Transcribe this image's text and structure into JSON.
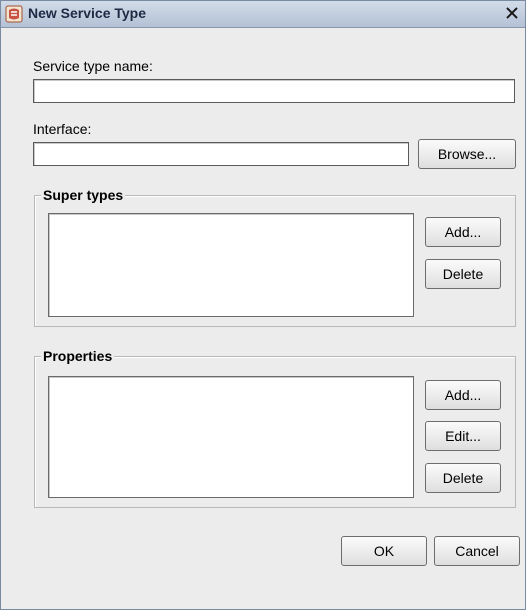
{
  "window": {
    "title": "New Service Type",
    "close_glyph": "✕"
  },
  "service_type": {
    "label": "Service type name:",
    "value": ""
  },
  "interface": {
    "label": "Interface:",
    "value": "",
    "browse_label": "Browse..."
  },
  "super_types": {
    "title": "Super types",
    "items": [],
    "add_label": "Add...",
    "delete_label": "Delete"
  },
  "properties": {
    "title": "Properties",
    "items": [],
    "add_label": "Add...",
    "edit_label": "Edit...",
    "delete_label": "Delete"
  },
  "footer": {
    "ok_label": "OK",
    "cancel_label": "Cancel"
  },
  "colors": {
    "titlebar": "#b4c2d6",
    "dialog_bg": "#ececec",
    "icon_red": "#c0392b"
  }
}
